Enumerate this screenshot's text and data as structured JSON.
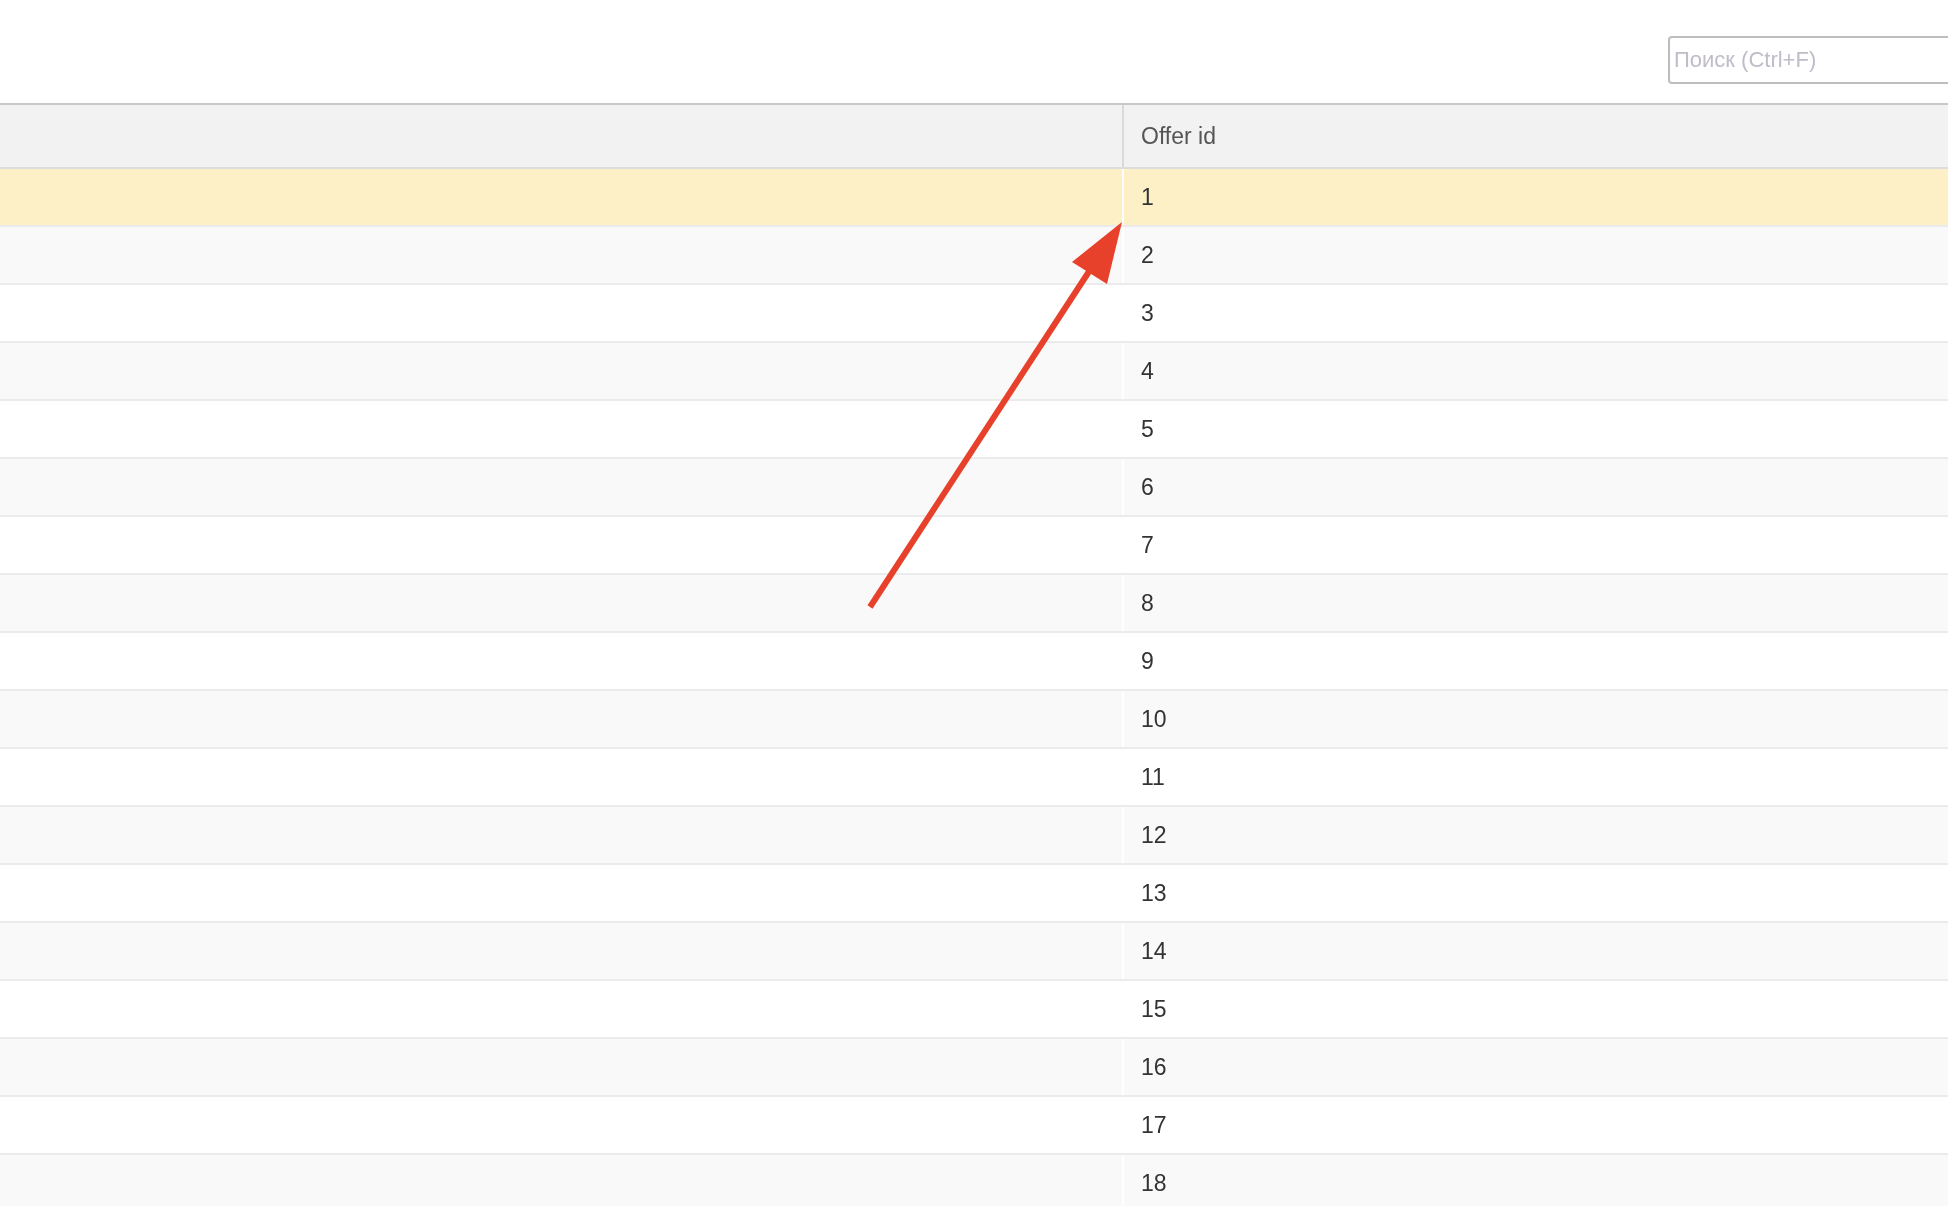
{
  "search": {
    "placeholder": "Поиск (Ctrl+F)"
  },
  "table": {
    "columns": [
      "Offer id"
    ],
    "rows": [
      {
        "offer_id": "1",
        "selected": true
      },
      {
        "offer_id": "2",
        "selected": false
      },
      {
        "offer_id": "3",
        "selected": false
      },
      {
        "offer_id": "4",
        "selected": false
      },
      {
        "offer_id": "5",
        "selected": false
      },
      {
        "offer_id": "6",
        "selected": false
      },
      {
        "offer_id": "7",
        "selected": false
      },
      {
        "offer_id": "8",
        "selected": false
      },
      {
        "offer_id": "9",
        "selected": false
      },
      {
        "offer_id": "10",
        "selected": false
      },
      {
        "offer_id": "11",
        "selected": false
      },
      {
        "offer_id": "12",
        "selected": false
      },
      {
        "offer_id": "13",
        "selected": false
      },
      {
        "offer_id": "14",
        "selected": false
      },
      {
        "offer_id": "15",
        "selected": false
      },
      {
        "offer_id": "16",
        "selected": false
      },
      {
        "offer_id": "17",
        "selected": false
      },
      {
        "offer_id": "18",
        "selected": false
      }
    ]
  }
}
